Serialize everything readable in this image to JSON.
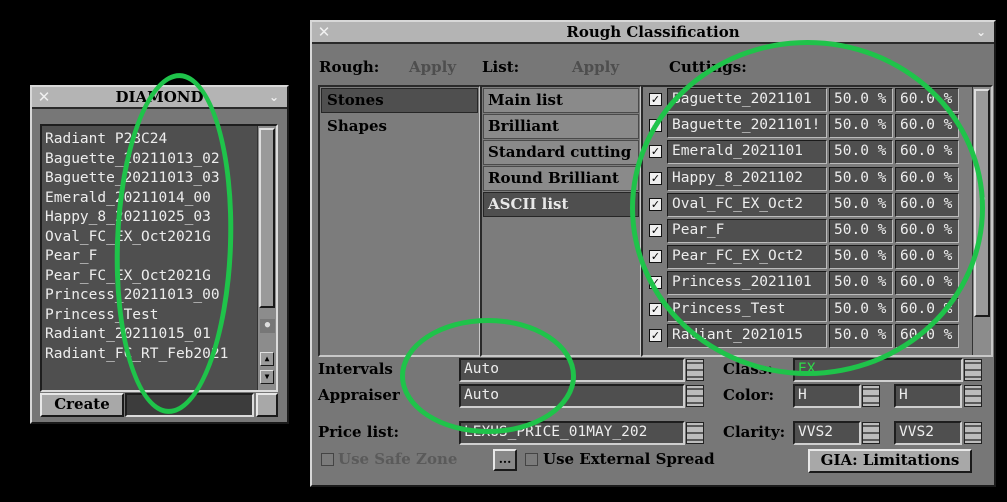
{
  "diamond_window": {
    "title": "DIAMOND",
    "close_glyph": "✕",
    "menu_glyph": "⌄",
    "items": [
      "Radiant P28C24",
      "Baguette_20211013_02",
      "Baguette_20211013_03",
      "Emerald_20211014_00",
      "Happy_8_20211025_03",
      "Oval_FC_EX_Oct2021G",
      "Pear_F",
      "Pear_FC_EX_Oct2021G",
      "Princess_20211013_00",
      "Princess_Test",
      "Radiant_20211015_01",
      "Radiant_FC_RT_Feb2021"
    ],
    "create_label": "Create",
    "create_field_value": ""
  },
  "rough_window": {
    "title": "Rough Classification",
    "close_glyph": "✕",
    "menu_glyph": "⌄",
    "rough_label": "Rough:",
    "rough_apply": "Apply",
    "list_label": "List:",
    "list_apply": "Apply",
    "cuttings_label": "Cuttings:",
    "rough_items": [
      {
        "label": "Stones",
        "selected": true
      },
      {
        "label": "Shapes",
        "selected": false
      }
    ],
    "list_items": [
      {
        "label": "Main list",
        "selected": false
      },
      {
        "label": "Brilliant",
        "selected": false
      },
      {
        "label": "Standard cutting",
        "selected": false
      },
      {
        "label": "Round Brilliant",
        "selected": false
      },
      {
        "label": "ASCII list",
        "selected": true
      }
    ],
    "cuttings": [
      {
        "name": "Baguette_2021101",
        "checked": true,
        "v1": "50.0 %",
        "v2": "60.0 %"
      },
      {
        "name": "Baguette_2021101!",
        "checked": true,
        "v1": "50.0 %",
        "v2": "60.0 %"
      },
      {
        "name": "Emerald_2021101",
        "checked": true,
        "v1": "50.0 %",
        "v2": "60.0 %"
      },
      {
        "name": "Happy_8_2021102",
        "checked": true,
        "v1": "50.0 %",
        "v2": "60.0 %"
      },
      {
        "name": "Oval_FC_EX_Oct2",
        "checked": true,
        "v1": "50.0 %",
        "v2": "60.0 %"
      },
      {
        "name": "Pear_F",
        "checked": true,
        "v1": "50.0 %",
        "v2": "60.0 %"
      },
      {
        "name": "Pear_FC_EX_Oct2",
        "checked": true,
        "v1": "50.0 %",
        "v2": "60.0 %"
      },
      {
        "name": "Princess_2021101",
        "checked": true,
        "v1": "50.0 %",
        "v2": "60.0 %"
      },
      {
        "name": "Princess_Test",
        "checked": true,
        "v1": "50.0 %",
        "v2": "60.0 %"
      },
      {
        "name": "Radiant_2021015",
        "checked": true,
        "v1": "50.0 %",
        "v2": "60.0 %"
      }
    ],
    "check_glyph": "✓",
    "intervals_label": "Intervals",
    "intervals_value": "Auto",
    "appraiser_label": "Appraiser",
    "appraiser_value": "Auto",
    "price_list_label": "Price list:",
    "price_list_value": "LEXUS_PRICE_01MAY_202",
    "class_label": "Class:",
    "class_value": "EX",
    "color_label": "Color:",
    "color_from": "H",
    "color_to": "H",
    "clarity_label": "Clarity:",
    "clarity_from": "VVS2",
    "clarity_to": "VVS2",
    "safe_zone_label": "Use Safe Zone",
    "ellipsis_label": "...",
    "external_spread_label": "Use External Spread",
    "gia_label": "GIA: Limitations"
  },
  "colors": {
    "highlight_ring": "#1fc34a",
    "class_value": "#2fd84a"
  }
}
